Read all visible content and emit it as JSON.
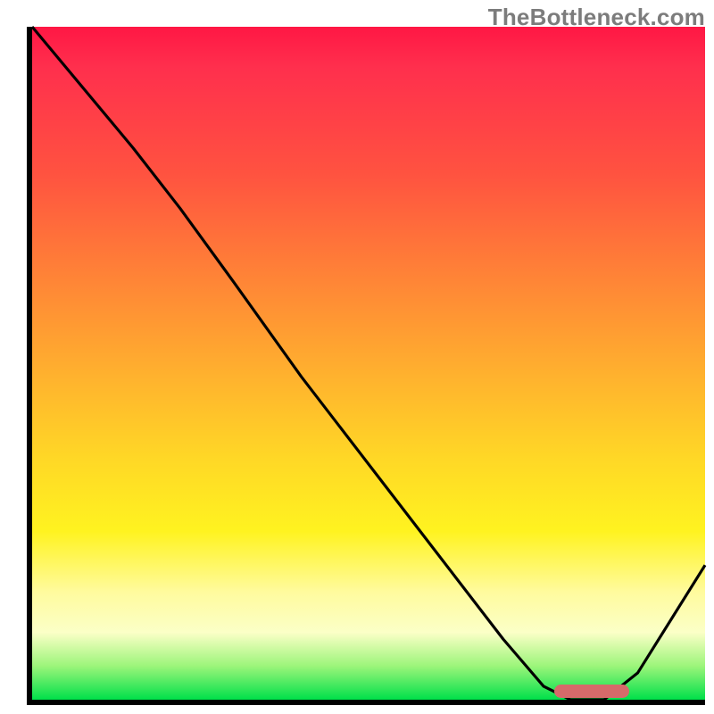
{
  "watermark": {
    "text": "TheBottleneck.com"
  },
  "chart_data": {
    "type": "line",
    "title": "",
    "xlabel": "",
    "ylabel": "",
    "xlim": [
      0,
      100
    ],
    "ylim": [
      0,
      100
    ],
    "grid": false,
    "legend": false,
    "series": [
      {
        "name": "bottleneck-curve",
        "x": [
          0,
          5,
          15,
          22,
          30,
          40,
          50,
          60,
          70,
          76,
          80,
          85,
          90,
          95,
          100
        ],
        "values": [
          100,
          94,
          82,
          73,
          62,
          48,
          35,
          22,
          9,
          2,
          0,
          0,
          4,
          12,
          20
        ]
      }
    ],
    "indicator": {
      "x_start": 77,
      "x_end": 88,
      "y": 1
    },
    "gradient_stops": [
      {
        "pct": 0,
        "color": "#ff1744"
      },
      {
        "pct": 22,
        "color": "#ff5340"
      },
      {
        "pct": 52,
        "color": "#ffb22e"
      },
      {
        "pct": 75,
        "color": "#fff320"
      },
      {
        "pct": 90,
        "color": "#fbffc7"
      },
      {
        "pct": 100,
        "color": "#00e04a"
      }
    ]
  }
}
